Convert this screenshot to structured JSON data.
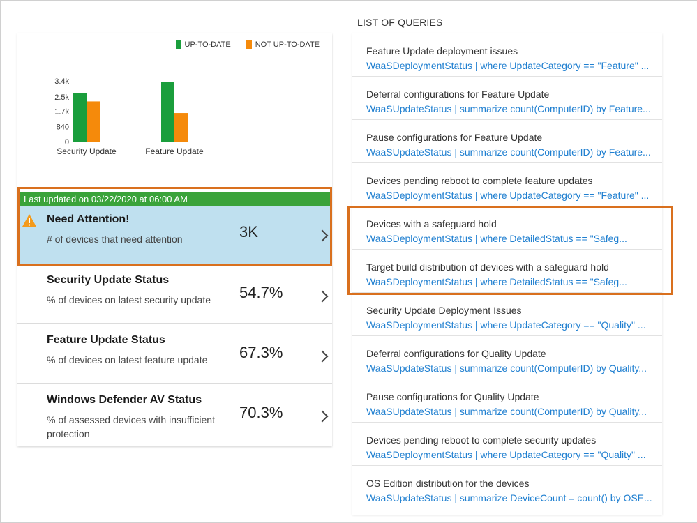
{
  "colors": {
    "up_to_date": "#1a9e3c",
    "not_up_to_date": "#f58a0b",
    "status_bar": "#3aa33a",
    "highlight": "#d9701e",
    "link": "#1f7fd0",
    "attention_bg": "#bfe0ef"
  },
  "chart_data": {
    "type": "bar",
    "categories": [
      "Security Update",
      "Feature Update"
    ],
    "series": [
      {
        "name": "UP-TO-DATE",
        "values": [
          2700,
          3350
        ]
      },
      {
        "name": "NOT UP-TO-DATE",
        "values": [
          2250,
          1600
        ]
      }
    ],
    "yticks": [
      "0",
      "840",
      "1.7k",
      "2.5k",
      "3.4k"
    ],
    "ylim": [
      0,
      3400
    ],
    "legend": "top-right"
  },
  "status_bar": "Last updated on 03/22/2020 at 06:00 AM",
  "rows": [
    {
      "title": "Need Attention!",
      "sub": "# of devices that need attention",
      "value": "3K",
      "icon": "warning-icon"
    },
    {
      "title": "Security Update Status",
      "sub": "% of devices on latest security update",
      "value": "54.7%"
    },
    {
      "title": "Feature Update Status",
      "sub": "% of devices on latest feature update",
      "value": "67.3%"
    },
    {
      "title": "Windows Defender AV Status",
      "sub": "% of assessed devices with insufficient protection",
      "value": "70.3%"
    }
  ],
  "queries_title": "LIST OF QUERIES",
  "queries": [
    {
      "name": "Feature Update deployment issues",
      "code": "WaaSDeploymentStatus | where UpdateCategory == \"Feature\" ..."
    },
    {
      "name": "Deferral configurations for Feature Update",
      "code": "WaaSUpdateStatus | summarize count(ComputerID) by Feature..."
    },
    {
      "name": "Pause configurations for Feature Update",
      "code": "WaaSUpdateStatus | summarize count(ComputerID) by Feature..."
    },
    {
      "name": "Devices pending reboot to complete feature updates",
      "code": "WaaSDeploymentStatus | where UpdateCategory == \"Feature\" ..."
    },
    {
      "name": "Devices with a safeguard hold",
      "code": "WaaSDeploymentStatus | where DetailedStatus == \"Safeg..."
    },
    {
      "name": "Target build distribution of devices with a safeguard hold",
      "code": "WaaSDeploymentStatus | where DetailedStatus == \"Safeg..."
    },
    {
      "name": "Security Update Deployment Issues",
      "code": "WaaSDeploymentStatus | where UpdateCategory == \"Quality\" ..."
    },
    {
      "name": "Deferral configurations for Quality Update",
      "code": "WaaSUpdateStatus | summarize count(ComputerID) by Quality..."
    },
    {
      "name": "Pause configurations for Quality Update",
      "code": "WaaSUpdateStatus | summarize count(ComputerID) by Quality..."
    },
    {
      "name": "Devices pending reboot to complete security updates",
      "code": "WaaSDeploymentStatus | where UpdateCategory == \"Quality\" ..."
    },
    {
      "name": "OS Edition distribution for the devices",
      "code": "WaaSUpdateStatus | summarize DeviceCount = count() by OSE..."
    }
  ]
}
